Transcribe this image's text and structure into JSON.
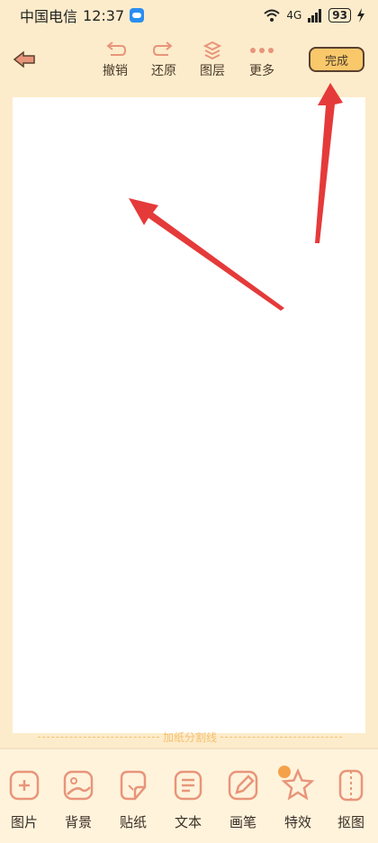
{
  "status_bar": {
    "carrier": "中国电信",
    "time": "12:37",
    "network": "4G",
    "battery": "93"
  },
  "toolbar": {
    "undo_label": "撤销",
    "redo_label": "还原",
    "layers_label": "图层",
    "more_label": "更多",
    "done_label": "完成"
  },
  "divider_label": "加纸分割线",
  "bottom_tools": [
    {
      "label": "图片",
      "icon": "image-add-icon"
    },
    {
      "label": "背景",
      "icon": "background-image-icon"
    },
    {
      "label": "贴纸",
      "icon": "sticker-icon"
    },
    {
      "label": "文本",
      "icon": "text-icon"
    },
    {
      "label": "画笔",
      "icon": "pen-icon"
    },
    {
      "label": "特效",
      "icon": "star-icon",
      "locked": true
    },
    {
      "label": "抠图",
      "icon": "cutout-icon"
    }
  ],
  "colors": {
    "background": "#fdeccb",
    "accent": "#f9c86a",
    "icon": "#e8957a",
    "arrow": "#e53a3a"
  }
}
